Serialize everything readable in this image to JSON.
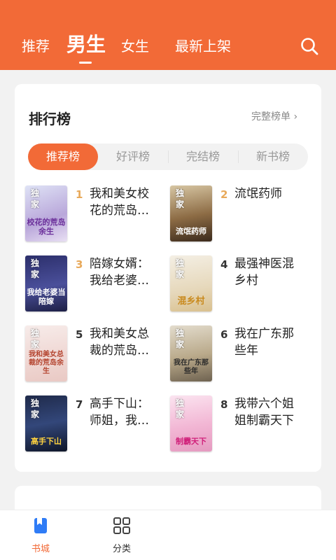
{
  "header": {
    "tabs": [
      {
        "label": "推荐",
        "active": false
      },
      {
        "label": "男生",
        "active": true
      },
      {
        "label": "女生",
        "active": false
      },
      {
        "label": "最新上架",
        "active": false
      }
    ],
    "search_icon": "search-icon",
    "bg_color": "#f26a37"
  },
  "ranking": {
    "title": "排行榜",
    "more": "完整榜单 ›",
    "segments": [
      {
        "label": "推荐榜",
        "active": true
      },
      {
        "label": "好评榜",
        "active": false
      },
      {
        "label": "完结榜",
        "active": false
      },
      {
        "label": "新书榜",
        "active": false
      }
    ],
    "books": [
      {
        "rank": "1",
        "title": "我和美女校花的荒岛…",
        "badge": "独家",
        "cover_text": "校花的荒岛余生"
      },
      {
        "rank": "2",
        "title": "流氓药师",
        "badge": "独家",
        "cover_text": "流氓药师"
      },
      {
        "rank": "3",
        "title": "陪嫁女婿：我给老婆…",
        "badge": "独家",
        "cover_text": "我给老婆当陪嫁"
      },
      {
        "rank": "4",
        "title": "最强神医混乡村",
        "badge": "独家",
        "cover_text": "混乡村"
      },
      {
        "rank": "5",
        "title": "我和美女总裁的荒岛…",
        "badge": "独家",
        "cover_text": "我和美女总裁的荒岛余生"
      },
      {
        "rank": "6",
        "title": "我在广东那些年",
        "badge": "独家",
        "cover_text": "我在广东那些年"
      },
      {
        "rank": "7",
        "title": "高手下山：师姐，我…",
        "badge": "独家",
        "cover_text": "高手下山"
      },
      {
        "rank": "8",
        "title": "我带六个姐姐制霸天下",
        "badge": "独家",
        "cover_text": "制霸天下"
      }
    ]
  },
  "bottom_nav": [
    {
      "label": "书城",
      "icon": "book-icon",
      "active": true
    },
    {
      "label": "分类",
      "icon": "grid-icon",
      "active": false
    }
  ],
  "colors": {
    "accent": "#f26a37",
    "rank_gold": "#e8a95a"
  }
}
